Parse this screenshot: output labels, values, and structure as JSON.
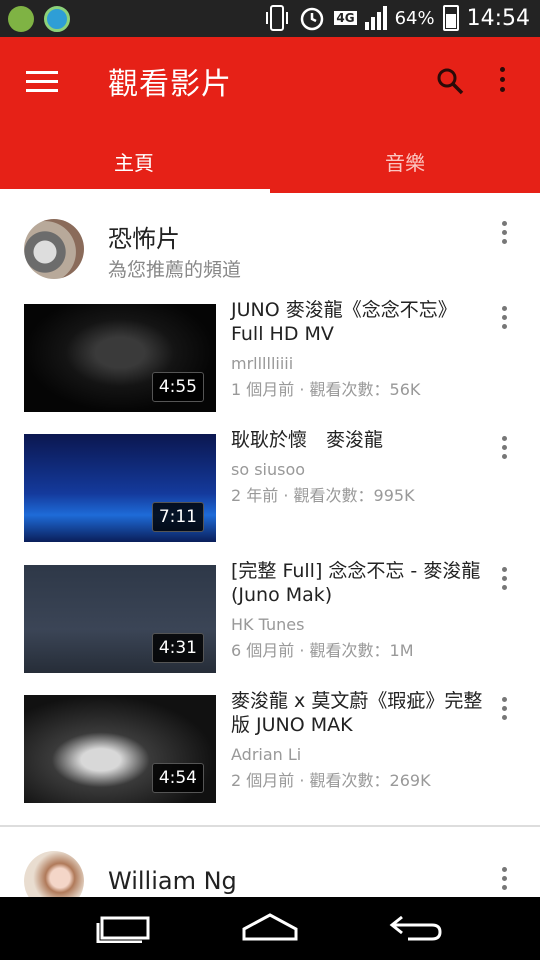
{
  "status_bar": {
    "network": "4G",
    "battery": "64%",
    "battery_level": 0.64,
    "time": "14:54"
  },
  "app_bar": {
    "title": "觀看影片"
  },
  "tabs": [
    {
      "label": "主頁",
      "selected": true
    },
    {
      "label": "音樂",
      "selected": false
    }
  ],
  "sections": [
    {
      "title": "恐怖片",
      "subtitle": "為您推薦的頻道",
      "videos": [
        {
          "title": "JUNO 麥浚龍《念念不忘》Full HD MV",
          "channel": "mrllllliiii",
          "meta": "1 個月前 · 觀看次數：56K",
          "duration": "4:55"
        },
        {
          "title": "耿耿於懷　麥浚龍",
          "channel": "so siusoo",
          "meta": "2 年前 · 觀看次數：995K",
          "duration": "7:11"
        },
        {
          "title": "[完整 Full] 念念不忘 - 麥浚龍 (Juno Mak)",
          "channel": "HK Tunes",
          "meta": "6 個月前 · 觀看次數：1M",
          "duration": "4:31"
        },
        {
          "title": "麥浚龍 x 莫文蔚《瑕疵》完整版 JUNO MAK",
          "channel": "Adrian Li",
          "meta": "2 個月前 · 觀看次數：269K",
          "duration": "4:54"
        }
      ]
    },
    {
      "title": "William Ng"
    }
  ],
  "colors": {
    "accent": "#e62117",
    "status_bar": "#232323",
    "nav_bar": "#000000"
  }
}
